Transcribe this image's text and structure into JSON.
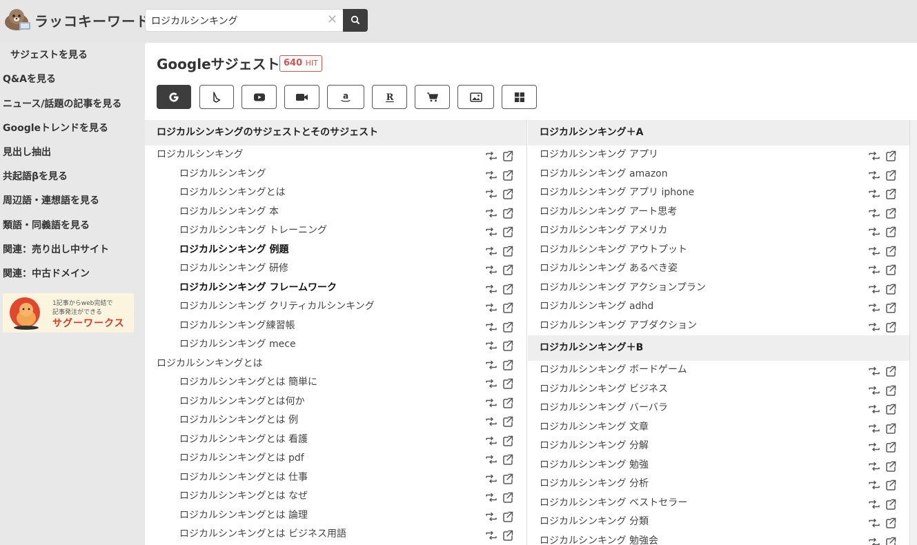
{
  "app": {
    "logo_text": "ラッコキーワード",
    "logo_icon": "otter-logo-icon"
  },
  "search": {
    "value": "ロジカルシンキング",
    "clear_icon": "close-icon",
    "button_icon": "search-icon"
  },
  "sidebar": {
    "items": [
      {
        "label": "サジェストを見る"
      },
      {
        "label": "Q&Aを見る"
      },
      {
        "label": "ニュース/話題の記事を見る"
      },
      {
        "label": "Googleトレンドを見る"
      },
      {
        "label": "見出し抽出"
      },
      {
        "label": "共起語βを見る"
      },
      {
        "label": "周辺語・連想語を見る"
      },
      {
        "label": "類語・同義語を見る"
      },
      {
        "label": "関連：売り出し中サイト"
      },
      {
        "label": "関連：中古ドメイン"
      }
    ],
    "banner": {
      "line1": "1記事からweb完結で",
      "line2": "記事発注ができる",
      "brand": "サグーワークス"
    }
  },
  "main": {
    "title": "Googleサジェスト",
    "hit_count": "640",
    "hit_label": "HIT",
    "sources": [
      {
        "icon": "google-icon",
        "active": true
      },
      {
        "icon": "bing-icon",
        "active": false
      },
      {
        "icon": "youtube-icon",
        "active": false
      },
      {
        "icon": "video-icon",
        "active": false
      },
      {
        "icon": "amazon-icon",
        "active": false
      },
      {
        "icon": "rakuten-icon",
        "active": false
      },
      {
        "icon": "shopping-cart-icon",
        "active": false
      },
      {
        "icon": "image-icon",
        "active": false
      },
      {
        "icon": "windows-icon",
        "active": false
      }
    ],
    "left_column": {
      "heading": "ロジカルシンキングのサジェストとそのサジェスト",
      "rows": [
        {
          "text": "ロジカルシンキング",
          "sub": false,
          "bold": false
        },
        {
          "text": "ロジカルシンキング",
          "sub": true,
          "bold": false
        },
        {
          "text": "ロジカルシンキングとは",
          "sub": true,
          "bold": false
        },
        {
          "text": "ロジカルシンキング 本",
          "sub": true,
          "bold": false
        },
        {
          "text": "ロジカルシンキング トレーニング",
          "sub": true,
          "bold": false
        },
        {
          "text": "ロジカルシンキング 例題",
          "sub": true,
          "bold": true
        },
        {
          "text": "ロジカルシンキング 研修",
          "sub": true,
          "bold": false
        },
        {
          "text": "ロジカルシンキング フレームワーク",
          "sub": true,
          "bold": true
        },
        {
          "text": "ロジカルシンキング クリティカルシンキング",
          "sub": true,
          "bold": false
        },
        {
          "text": "ロジカルシンキング練習帳",
          "sub": true,
          "bold": false
        },
        {
          "text": "ロジカルシンキング mece",
          "sub": true,
          "bold": false
        },
        {
          "text": "ロジカルシンキングとは",
          "sub": false,
          "bold": false
        },
        {
          "text": "ロジカルシンキングとは 簡単に",
          "sub": true,
          "bold": false
        },
        {
          "text": "ロジカルシンキングとは何か",
          "sub": true,
          "bold": false
        },
        {
          "text": "ロジカルシンキングとは 例",
          "sub": true,
          "bold": false
        },
        {
          "text": "ロジカルシンキングとは 看護",
          "sub": true,
          "bold": false
        },
        {
          "text": "ロジカルシンキングとは pdf",
          "sub": true,
          "bold": false
        },
        {
          "text": "ロジカルシンキングとは 仕事",
          "sub": true,
          "bold": false
        },
        {
          "text": "ロジカルシンキングとは なぜ",
          "sub": true,
          "bold": false
        },
        {
          "text": "ロジカルシンキングとは 論理",
          "sub": true,
          "bold": false
        },
        {
          "text": "ロジカルシンキングとは ビジネス用語",
          "sub": true,
          "bold": false
        }
      ]
    },
    "right_column": {
      "groups": [
        {
          "heading": "ロジカルシンキング＋A",
          "rows": [
            "ロジカルシンキング アプリ",
            "ロジカルシンキング amazon",
            "ロジカルシンキング アプリ iphone",
            "ロジカルシンキング アート思考",
            "ロジカルシンキング アメリカ",
            "ロジカルシンキング アウトプット",
            "ロジカルシンキング あるべき姿",
            "ロジカルシンキング アクションプラン",
            "ロジカルシンキング adhd",
            "ロジカルシンキング アブダクション"
          ]
        },
        {
          "heading": "ロジカルシンキング＋B",
          "rows": [
            "ロジカルシンキング ボードゲーム",
            "ロジカルシンキング ビジネス",
            "ロジカルシンキング バーバラ",
            "ロジカルシンキング 文章",
            "ロジカルシンキング 分解",
            "ロジカルシンキング 勉強",
            "ロジカルシンキング 分析",
            "ロジカルシンキング ベストセラー",
            "ロジカルシンキング 分類",
            "ロジカルシンキング 勉強会"
          ]
        }
      ]
    },
    "row_actions": {
      "retweet_icon": "retweet-icon",
      "external_icon": "external-link-icon"
    }
  }
}
